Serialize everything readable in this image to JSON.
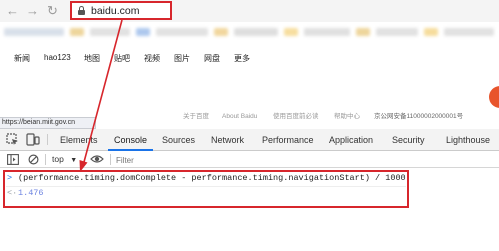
{
  "browser": {
    "nav_back": "←",
    "nav_forward": "→",
    "nav_reload": "↻",
    "url": "baidu.com"
  },
  "page": {
    "nav_links": [
      "新闻",
      "hao123",
      "地图",
      "贴吧",
      "视频",
      "图片",
      "网盘",
      "更多"
    ],
    "footer_links": [
      "关于百度",
      "About Baidu",
      "使用百度前必读",
      "帮助中心",
      "京公网安备11000002000001号"
    ]
  },
  "status_bar": {
    "url": "https://beian.miit.gov.cn"
  },
  "devtools": {
    "tabs": [
      "Elements",
      "Console",
      "Sources",
      "Network",
      "Performance",
      "Application",
      "Security",
      "Lighthouse"
    ],
    "active_tab": "Console",
    "context": "top",
    "filter_placeholder": "Filter",
    "console": {
      "command": "(performance.timing.domComplete - performance.timing.navigationStart) / 1000",
      "result": "1.476"
    }
  },
  "colors": {
    "highlight": "#d7262c",
    "active_tab_underline": "#1a73e8"
  }
}
